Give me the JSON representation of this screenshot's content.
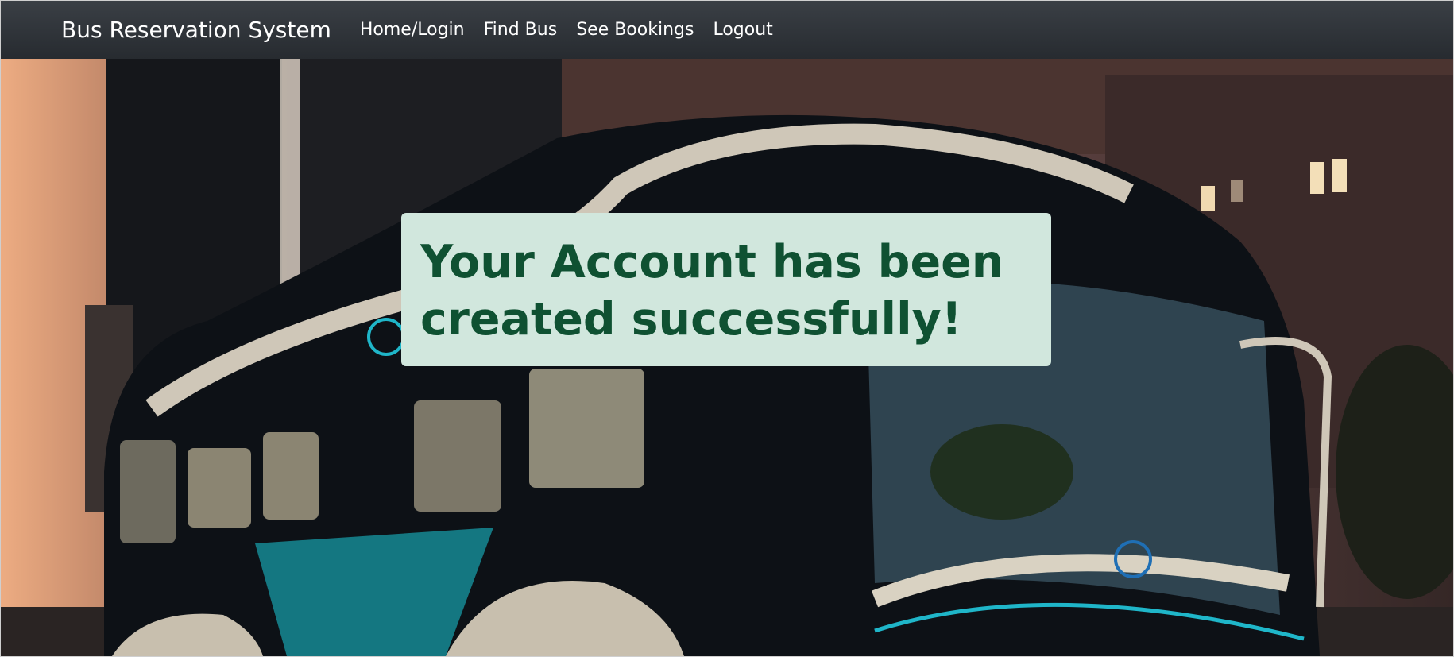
{
  "navbar": {
    "brand": "Bus Reservation System",
    "links": [
      "Home/Login",
      "Find Bus",
      "See Bookings",
      "Logout"
    ]
  },
  "alert": {
    "message_line1": "Your Account has been",
    "message_line2": "created successfully!"
  },
  "colors": {
    "navbar_bg": "#2b3035",
    "alert_bg": "#d1e7dd",
    "alert_text": "#0f5132"
  }
}
